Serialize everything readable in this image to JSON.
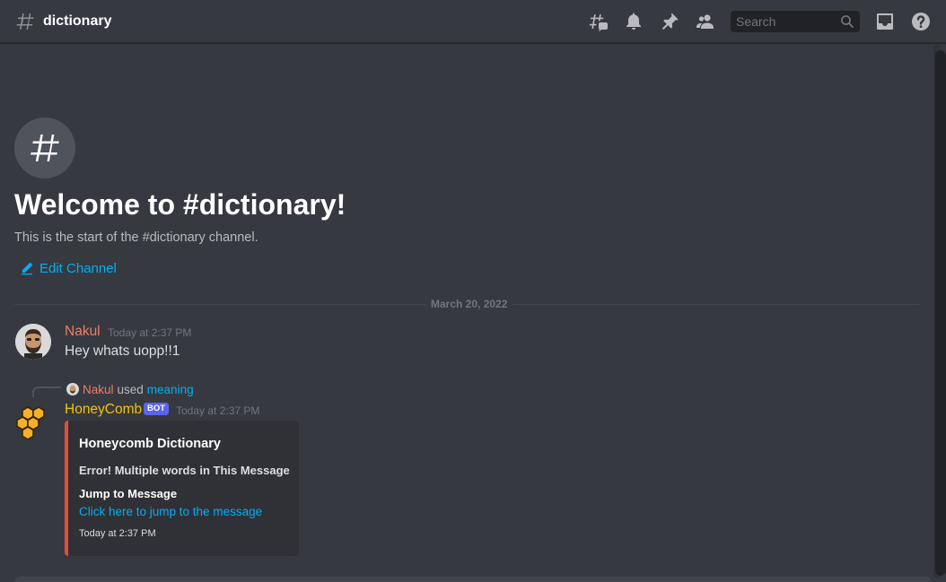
{
  "header": {
    "channel_name": "dictionary",
    "search_placeholder": "Search",
    "icons": [
      "threads-icon",
      "bell-icon",
      "pin-icon",
      "members-icon",
      "search-icon",
      "inbox-icon",
      "help-icon"
    ]
  },
  "welcome": {
    "title": "Welcome to #dictionary!",
    "subtitle": "This is the start of the #dictionary channel.",
    "edit_label": "Edit Channel"
  },
  "divider": {
    "date": "March 20, 2022"
  },
  "messages": [
    {
      "author": "Nakul",
      "author_color": "#f47b67",
      "timestamp": "Today at 2:37 PM",
      "text": "Hey whats uopp!!1"
    },
    {
      "reply": {
        "user": "Nakul",
        "used": "used",
        "command": "meaning"
      },
      "author": "HoneyComb",
      "author_color": "#f1c40f",
      "bot_tag": "BOT",
      "timestamp": "Today at 2:37 PM",
      "embed": {
        "color": "#e74c3c",
        "title": "Honeycomb Dictionary",
        "description": "Error! Multiple words in This Message",
        "field_name": "Jump to Message",
        "field_value": "Click here to jump to the message",
        "footer": "Today at 2:37 PM"
      }
    }
  ],
  "colors": {
    "background": "#36393f",
    "link": "#00b0f4",
    "bot_tag": "#5865f2"
  }
}
